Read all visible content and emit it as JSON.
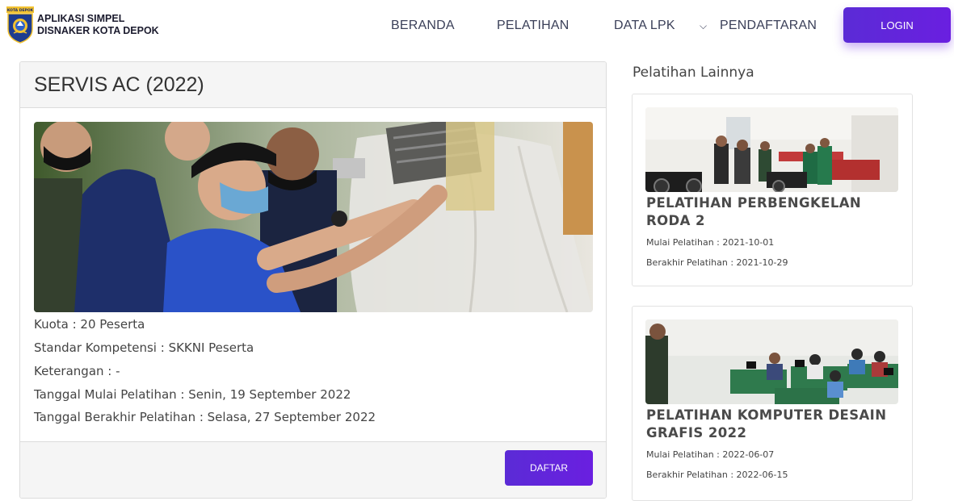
{
  "navbar": {
    "brand_line1": "APLIKASI SIMPEL",
    "brand_line2": "DISNAKER KOTA DEPOK",
    "logo_badge": "KOTA DEPOK",
    "menu": [
      "BERANDA",
      "PELATIHAN",
      "DATA LPK",
      "PENDAFTARAN"
    ],
    "login_label": "LOGIN",
    "accent": "#6a1fe0"
  },
  "training": {
    "title": "SERVIS AC (2022)",
    "kuota": "Kuota : 20 Peserta",
    "standar": "Standar Kompetensi : SKKNI Peserta",
    "keterangan": "Keterangan : -",
    "mulai": "Tanggal Mulai Pelatihan : Senin, 19 September 2022",
    "berakhir": "Tanggal Berakhir Pelatihan : Selasa, 27 September 2022",
    "register_label": "DAFTAR"
  },
  "sidebar": {
    "heading": "Pelatihan Lainnya",
    "items": [
      {
        "title": "PELATIHAN PERBENGKELAN RODA 2",
        "mulai": "Mulai Pelatihan : 2021-10-01",
        "berakhir": "Berakhir Pelatihan : 2021-10-29"
      },
      {
        "title": "PELATIHAN KOMPUTER DESAIN GRAFIS 2022",
        "mulai": "Mulai Pelatihan : 2022-06-07",
        "berakhir": "Berakhir Pelatihan : 2022-06-15"
      }
    ]
  }
}
